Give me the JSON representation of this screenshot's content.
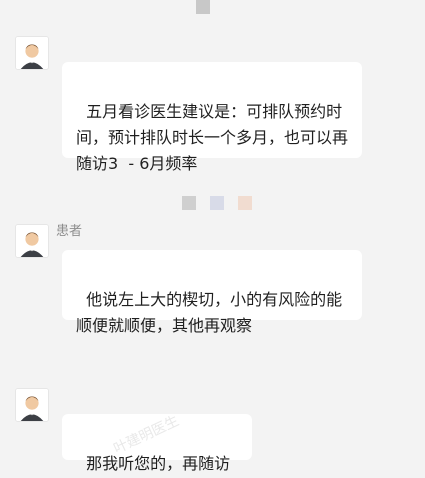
{
  "messages": [
    {
      "sender": "",
      "text": "五月看诊医生建议是：可排队预约时间，预计排队时长一个多月，也可以再随访3  - 6月频率"
    },
    {
      "sender": "患者",
      "text": "他说左上大的楔切，小的有风险的能顺便就顺便，其他再观察"
    },
    {
      "sender": "",
      "text": "那我听您的，再随访"
    }
  ],
  "watermark": "叶建明医生"
}
